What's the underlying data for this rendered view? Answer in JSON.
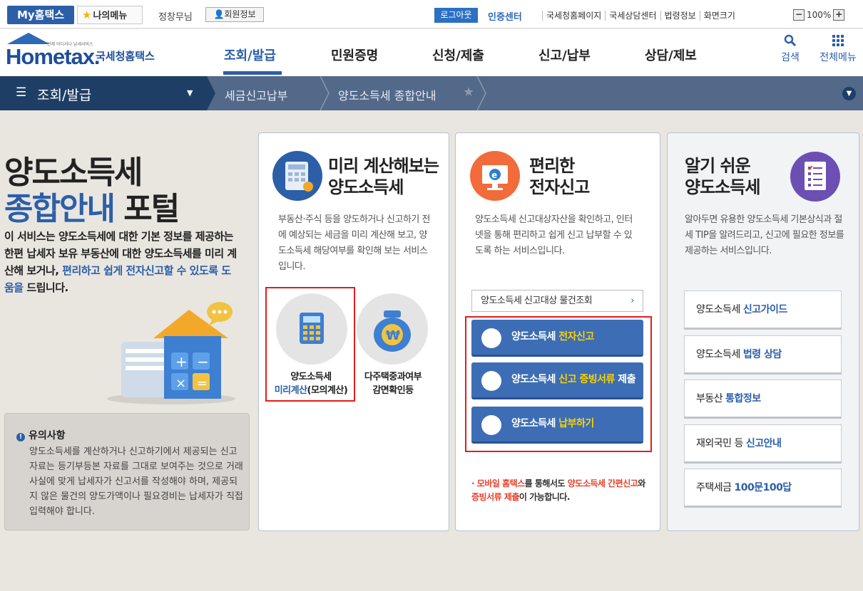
{
  "topbar": {
    "my_hometax": "My홈택스",
    "my_menu": "나의메뉴",
    "user_name": "정창무님",
    "member_info": "회원정보",
    "logout": "로그아웃",
    "cert_center": "인증센터",
    "links": [
      "국세청홈페이지",
      "국세상담센터",
      "법령정보",
      "화면크기"
    ],
    "zoom": "100%"
  },
  "header": {
    "logo_sub": "언제 어디서나 납세서비스",
    "logo_text": "Hometax.",
    "logo_name": "국세청홈택스",
    "gnb": [
      "조회/발급",
      "민원증명",
      "신청/제출",
      "신고/납부",
      "상담/제보"
    ],
    "search": "검색",
    "all_menu": "전체메뉴"
  },
  "location": {
    "first": "조회/발급",
    "second": "세금신고납부",
    "third": "양도소득세 종합안내"
  },
  "intro": {
    "title_line1": "양도소득세",
    "title_line2_blue": "종합안내",
    "title_line2_dark": "포털",
    "desc_1": "이 서비스는 양도소득세에 대한 기본 정보를 제공하는 한편 납세자 보유 부동산에 대한 양도소득세를 미리 계산해 보거나, ",
    "desc_hl": "편리하고 쉽게 전자신고할 수 있도록 도움을",
    "desc_2": " 드립니다."
  },
  "notice": {
    "title": "유의사항",
    "body": "양도소득세를 계산하거나 신고하기에서 제공되는 신고 자료는 등기부등본 자료를 그대로 보여주는 것으로 거래 사실에 맞게 납세자가 신고서를 작성해야 하며, 제공되지 않은 물건의 양도가액이나 필요경비는 납세자가 직접 입력해야 합니다."
  },
  "card1": {
    "title_1": "미리 계산해보는",
    "title_2": "양도소득세",
    "desc": "부동산·주식 등을 양도하거나 신고하기 전에 예상되는 세금을 미리 계산해 보고, 양도소득세 해당여부를 확인해 보는 서비스입니다.",
    "btn1_line1": "양도소득세",
    "btn1_line2_blue": "미리계산",
    "btn1_line2_dark": "(모의계산)",
    "btn2_line1": "다주택중과여부",
    "btn2_line2": "감면확인등"
  },
  "card2": {
    "title_1": "편리한",
    "title_2": "전자신고",
    "desc": "양도소득세 신고대상자산을 확인하고, 인터넷을 통해 편리하고 쉽게 신고 납부할 수 있도록 하는 서비스입니다.",
    "lookup": "양도소득세 신고대상 물건조회",
    "btn1_a": "양도소득세 ",
    "btn1_b": "전자신고",
    "btn2_a": "양도소득세 ",
    "btn2_b": "신고 증빙서류",
    "btn2_c": " 제출",
    "btn3_a": "양도소득세 ",
    "btn3_b": "납부하기",
    "note_1": "모바일 홈택스",
    "note_2": "를 통해서도 ",
    "note_3": "양도소득세 간편신고",
    "note_4": "와 ",
    "note_5": "증빙서류 제출",
    "note_6": "이 가능합니다."
  },
  "card3": {
    "title_1": "알기 쉬운",
    "title_2": "양도소득세",
    "desc": "알아두면 유용한 양도소득세 기본상식과 절세 TIP을 알려드리고, 신고에 필요한 정보를 제공하는 서비스입니다.",
    "items": [
      {
        "a": "양도소득세 ",
        "b": "신고가이드"
      },
      {
        "a": "양도소득세 ",
        "b": "법령 상담"
      },
      {
        "a": "부동산 ",
        "b": "통합정보"
      },
      {
        "a": "재외국민 등 ",
        "b": "신고안내"
      },
      {
        "a": "주택세금 ",
        "b": "100문100답"
      }
    ]
  },
  "colors": {
    "brand_blue": "#2c5fa8",
    "nav_dark": "#1f3e66",
    "highlight_red": "#e21d1d",
    "button_blue": "#3d6eb5"
  }
}
